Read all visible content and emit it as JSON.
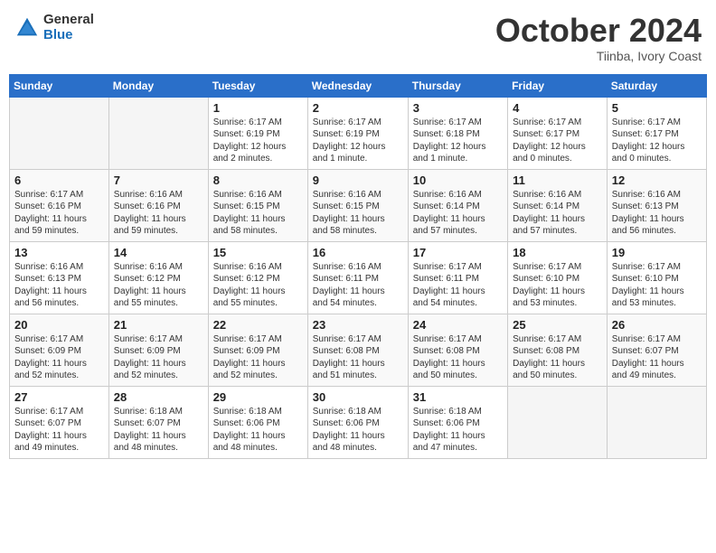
{
  "header": {
    "logo_general": "General",
    "logo_blue": "Blue",
    "month_title": "October 2024",
    "location": "Tiinba, Ivory Coast"
  },
  "weekdays": [
    "Sunday",
    "Monday",
    "Tuesday",
    "Wednesday",
    "Thursday",
    "Friday",
    "Saturday"
  ],
  "weeks": [
    [
      {
        "day": "",
        "info": "",
        "empty": true
      },
      {
        "day": "",
        "info": "",
        "empty": true
      },
      {
        "day": "1",
        "info": "Sunrise: 6:17 AM\nSunset: 6:19 PM\nDaylight: 12 hours\nand 2 minutes."
      },
      {
        "day": "2",
        "info": "Sunrise: 6:17 AM\nSunset: 6:19 PM\nDaylight: 12 hours\nand 1 minute."
      },
      {
        "day": "3",
        "info": "Sunrise: 6:17 AM\nSunset: 6:18 PM\nDaylight: 12 hours\nand 1 minute."
      },
      {
        "day": "4",
        "info": "Sunrise: 6:17 AM\nSunset: 6:17 PM\nDaylight: 12 hours\nand 0 minutes."
      },
      {
        "day": "5",
        "info": "Sunrise: 6:17 AM\nSunset: 6:17 PM\nDaylight: 12 hours\nand 0 minutes."
      }
    ],
    [
      {
        "day": "6",
        "info": "Sunrise: 6:17 AM\nSunset: 6:16 PM\nDaylight: 11 hours\nand 59 minutes."
      },
      {
        "day": "7",
        "info": "Sunrise: 6:16 AM\nSunset: 6:16 PM\nDaylight: 11 hours\nand 59 minutes."
      },
      {
        "day": "8",
        "info": "Sunrise: 6:16 AM\nSunset: 6:15 PM\nDaylight: 11 hours\nand 58 minutes."
      },
      {
        "day": "9",
        "info": "Sunrise: 6:16 AM\nSunset: 6:15 PM\nDaylight: 11 hours\nand 58 minutes."
      },
      {
        "day": "10",
        "info": "Sunrise: 6:16 AM\nSunset: 6:14 PM\nDaylight: 11 hours\nand 57 minutes."
      },
      {
        "day": "11",
        "info": "Sunrise: 6:16 AM\nSunset: 6:14 PM\nDaylight: 11 hours\nand 57 minutes."
      },
      {
        "day": "12",
        "info": "Sunrise: 6:16 AM\nSunset: 6:13 PM\nDaylight: 11 hours\nand 56 minutes."
      }
    ],
    [
      {
        "day": "13",
        "info": "Sunrise: 6:16 AM\nSunset: 6:13 PM\nDaylight: 11 hours\nand 56 minutes."
      },
      {
        "day": "14",
        "info": "Sunrise: 6:16 AM\nSunset: 6:12 PM\nDaylight: 11 hours\nand 55 minutes."
      },
      {
        "day": "15",
        "info": "Sunrise: 6:16 AM\nSunset: 6:12 PM\nDaylight: 11 hours\nand 55 minutes."
      },
      {
        "day": "16",
        "info": "Sunrise: 6:16 AM\nSunset: 6:11 PM\nDaylight: 11 hours\nand 54 minutes."
      },
      {
        "day": "17",
        "info": "Sunrise: 6:17 AM\nSunset: 6:11 PM\nDaylight: 11 hours\nand 54 minutes."
      },
      {
        "day": "18",
        "info": "Sunrise: 6:17 AM\nSunset: 6:10 PM\nDaylight: 11 hours\nand 53 minutes."
      },
      {
        "day": "19",
        "info": "Sunrise: 6:17 AM\nSunset: 6:10 PM\nDaylight: 11 hours\nand 53 minutes."
      }
    ],
    [
      {
        "day": "20",
        "info": "Sunrise: 6:17 AM\nSunset: 6:09 PM\nDaylight: 11 hours\nand 52 minutes."
      },
      {
        "day": "21",
        "info": "Sunrise: 6:17 AM\nSunset: 6:09 PM\nDaylight: 11 hours\nand 52 minutes."
      },
      {
        "day": "22",
        "info": "Sunrise: 6:17 AM\nSunset: 6:09 PM\nDaylight: 11 hours\nand 52 minutes."
      },
      {
        "day": "23",
        "info": "Sunrise: 6:17 AM\nSunset: 6:08 PM\nDaylight: 11 hours\nand 51 minutes."
      },
      {
        "day": "24",
        "info": "Sunrise: 6:17 AM\nSunset: 6:08 PM\nDaylight: 11 hours\nand 50 minutes."
      },
      {
        "day": "25",
        "info": "Sunrise: 6:17 AM\nSunset: 6:08 PM\nDaylight: 11 hours\nand 50 minutes."
      },
      {
        "day": "26",
        "info": "Sunrise: 6:17 AM\nSunset: 6:07 PM\nDaylight: 11 hours\nand 49 minutes."
      }
    ],
    [
      {
        "day": "27",
        "info": "Sunrise: 6:17 AM\nSunset: 6:07 PM\nDaylight: 11 hours\nand 49 minutes."
      },
      {
        "day": "28",
        "info": "Sunrise: 6:18 AM\nSunset: 6:07 PM\nDaylight: 11 hours\nand 48 minutes."
      },
      {
        "day": "29",
        "info": "Sunrise: 6:18 AM\nSunset: 6:06 PM\nDaylight: 11 hours\nand 48 minutes."
      },
      {
        "day": "30",
        "info": "Sunrise: 6:18 AM\nSunset: 6:06 PM\nDaylight: 11 hours\nand 48 minutes."
      },
      {
        "day": "31",
        "info": "Sunrise: 6:18 AM\nSunset: 6:06 PM\nDaylight: 11 hours\nand 47 minutes."
      },
      {
        "day": "",
        "info": "",
        "empty": true
      },
      {
        "day": "",
        "info": "",
        "empty": true
      }
    ]
  ]
}
